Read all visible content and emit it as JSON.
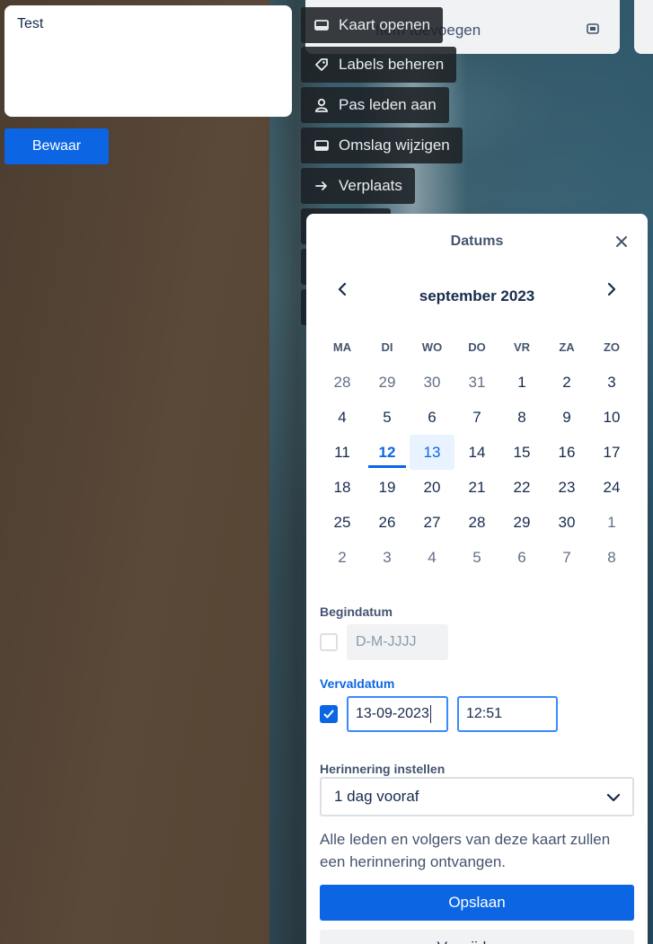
{
  "editor": {
    "text": "Test",
    "save_label": "Bewaar"
  },
  "background_card": {
    "text": "Item toevoegen",
    "icon": "template-icon"
  },
  "quick_actions": [
    {
      "label": "Kaart openen",
      "icon": "card-icon"
    },
    {
      "label": "Labels beheren",
      "icon": "tag-icon"
    },
    {
      "label": "Pas leden aan",
      "icon": "person-icon"
    },
    {
      "label": "Omslag wijzigen",
      "icon": "cover-icon"
    },
    {
      "label": "Verplaats",
      "icon": "arrow-right-icon"
    }
  ],
  "dates_popover": {
    "title": "Datums",
    "month": "september 2023",
    "weekdays": [
      "MA",
      "DI",
      "WO",
      "DO",
      "VR",
      "ZA",
      "ZO"
    ],
    "weeks": [
      [
        "28",
        "29",
        "30",
        "31",
        "1",
        "2",
        "3"
      ],
      [
        "4",
        "5",
        "6",
        "7",
        "8",
        "9",
        "10"
      ],
      [
        "11",
        "12",
        "13",
        "14",
        "15",
        "16",
        "17"
      ],
      [
        "18",
        "19",
        "20",
        "21",
        "22",
        "23",
        "24"
      ],
      [
        "25",
        "26",
        "27",
        "28",
        "29",
        "30",
        "1"
      ],
      [
        "2",
        "3",
        "4",
        "5",
        "6",
        "7",
        "8"
      ]
    ],
    "today": "12",
    "selected": "13",
    "start_date": {
      "label": "Begindatum",
      "placeholder": "D-M-JJJJ",
      "checked": false
    },
    "due_date": {
      "label": "Vervaldatum",
      "date": "13-09-2023",
      "time": "12:51",
      "checked": true
    },
    "reminder": {
      "label": "Herinnering instellen",
      "value": "1 dag vooraf",
      "hint": "Alle leden en volgers van deze kaart zullen een herinnering ontvangen."
    },
    "save_label": "Opslaan",
    "remove_label": "Verwijderen"
  },
  "colors": {
    "accent": "#0c66e4",
    "selected_bg": "#e9f2ff",
    "text": "#172b4d"
  }
}
